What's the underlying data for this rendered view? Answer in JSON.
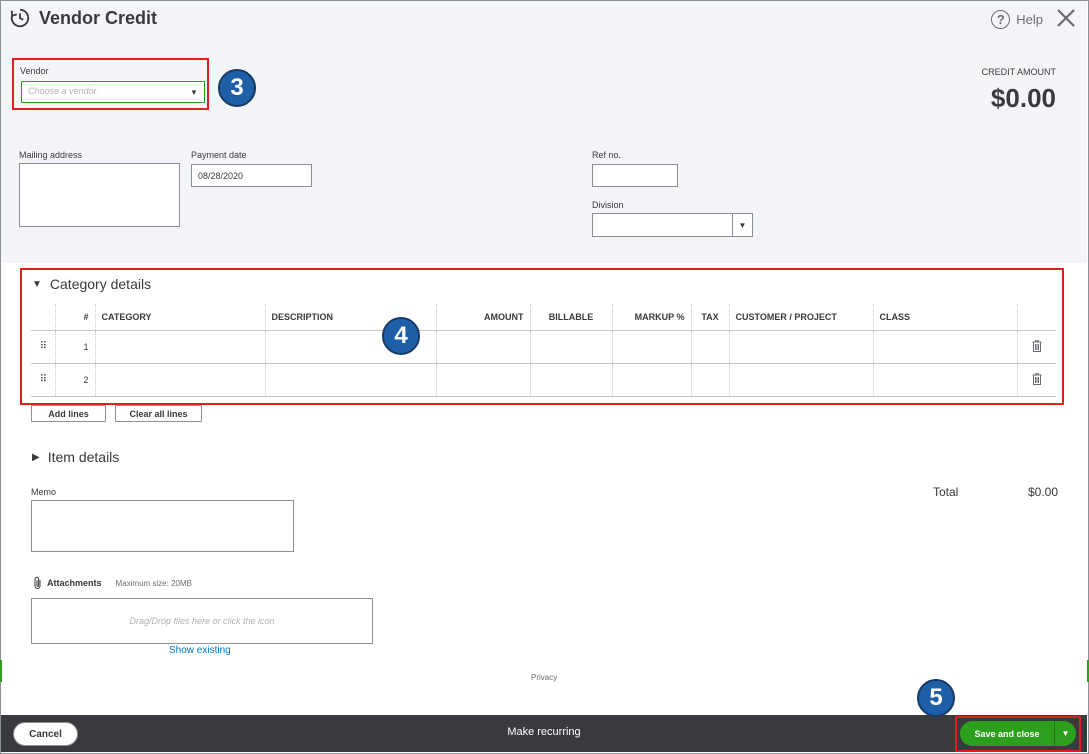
{
  "window": {
    "title": "Vendor Credit",
    "help_label": "Help"
  },
  "vendor": {
    "label": "Vendor",
    "placeholder": "Choose a vendor"
  },
  "credit": {
    "label": "CREDIT AMOUNT",
    "amount": "$0.00"
  },
  "fields": {
    "mailing_address_label": "Mailing address",
    "payment_date_label": "Payment date",
    "payment_date_value": "08/28/2020",
    "ref_no_label": "Ref no.",
    "division_label": "Division"
  },
  "badges": {
    "vendor": "3",
    "category": "4",
    "save": "5"
  },
  "category_details": {
    "title": "Category details",
    "columns": [
      "#",
      "CATEGORY",
      "DESCRIPTION",
      "AMOUNT",
      "BILLABLE",
      "MARKUP %",
      "TAX",
      "CUSTOMER / PROJECT",
      "CLASS"
    ],
    "rows": [
      {
        "num": "1"
      },
      {
        "num": "2"
      }
    ],
    "add_lines_label": "Add lines",
    "clear_lines_label": "Clear all lines"
  },
  "item_details": {
    "title": "Item details"
  },
  "memo": {
    "label": "Memo"
  },
  "total": {
    "label": "Total",
    "value": "$0.00"
  },
  "attachments": {
    "label": "Attachments",
    "max_size": "Maximum size: 20MB",
    "drop_text": "Drag/Drop files here or click the icon",
    "show_existing": "Show existing"
  },
  "privacy_label": "Privacy",
  "footer": {
    "cancel_label": "Cancel",
    "recurring_label": "Make recurring",
    "save_label": "Save and close"
  },
  "colors": {
    "accent_green": "#2ca01c",
    "highlight_red": "#e31c1c",
    "badge_blue": "#1f5fa8",
    "footer_dark": "#393a3d",
    "link_blue": "#0077c5"
  }
}
